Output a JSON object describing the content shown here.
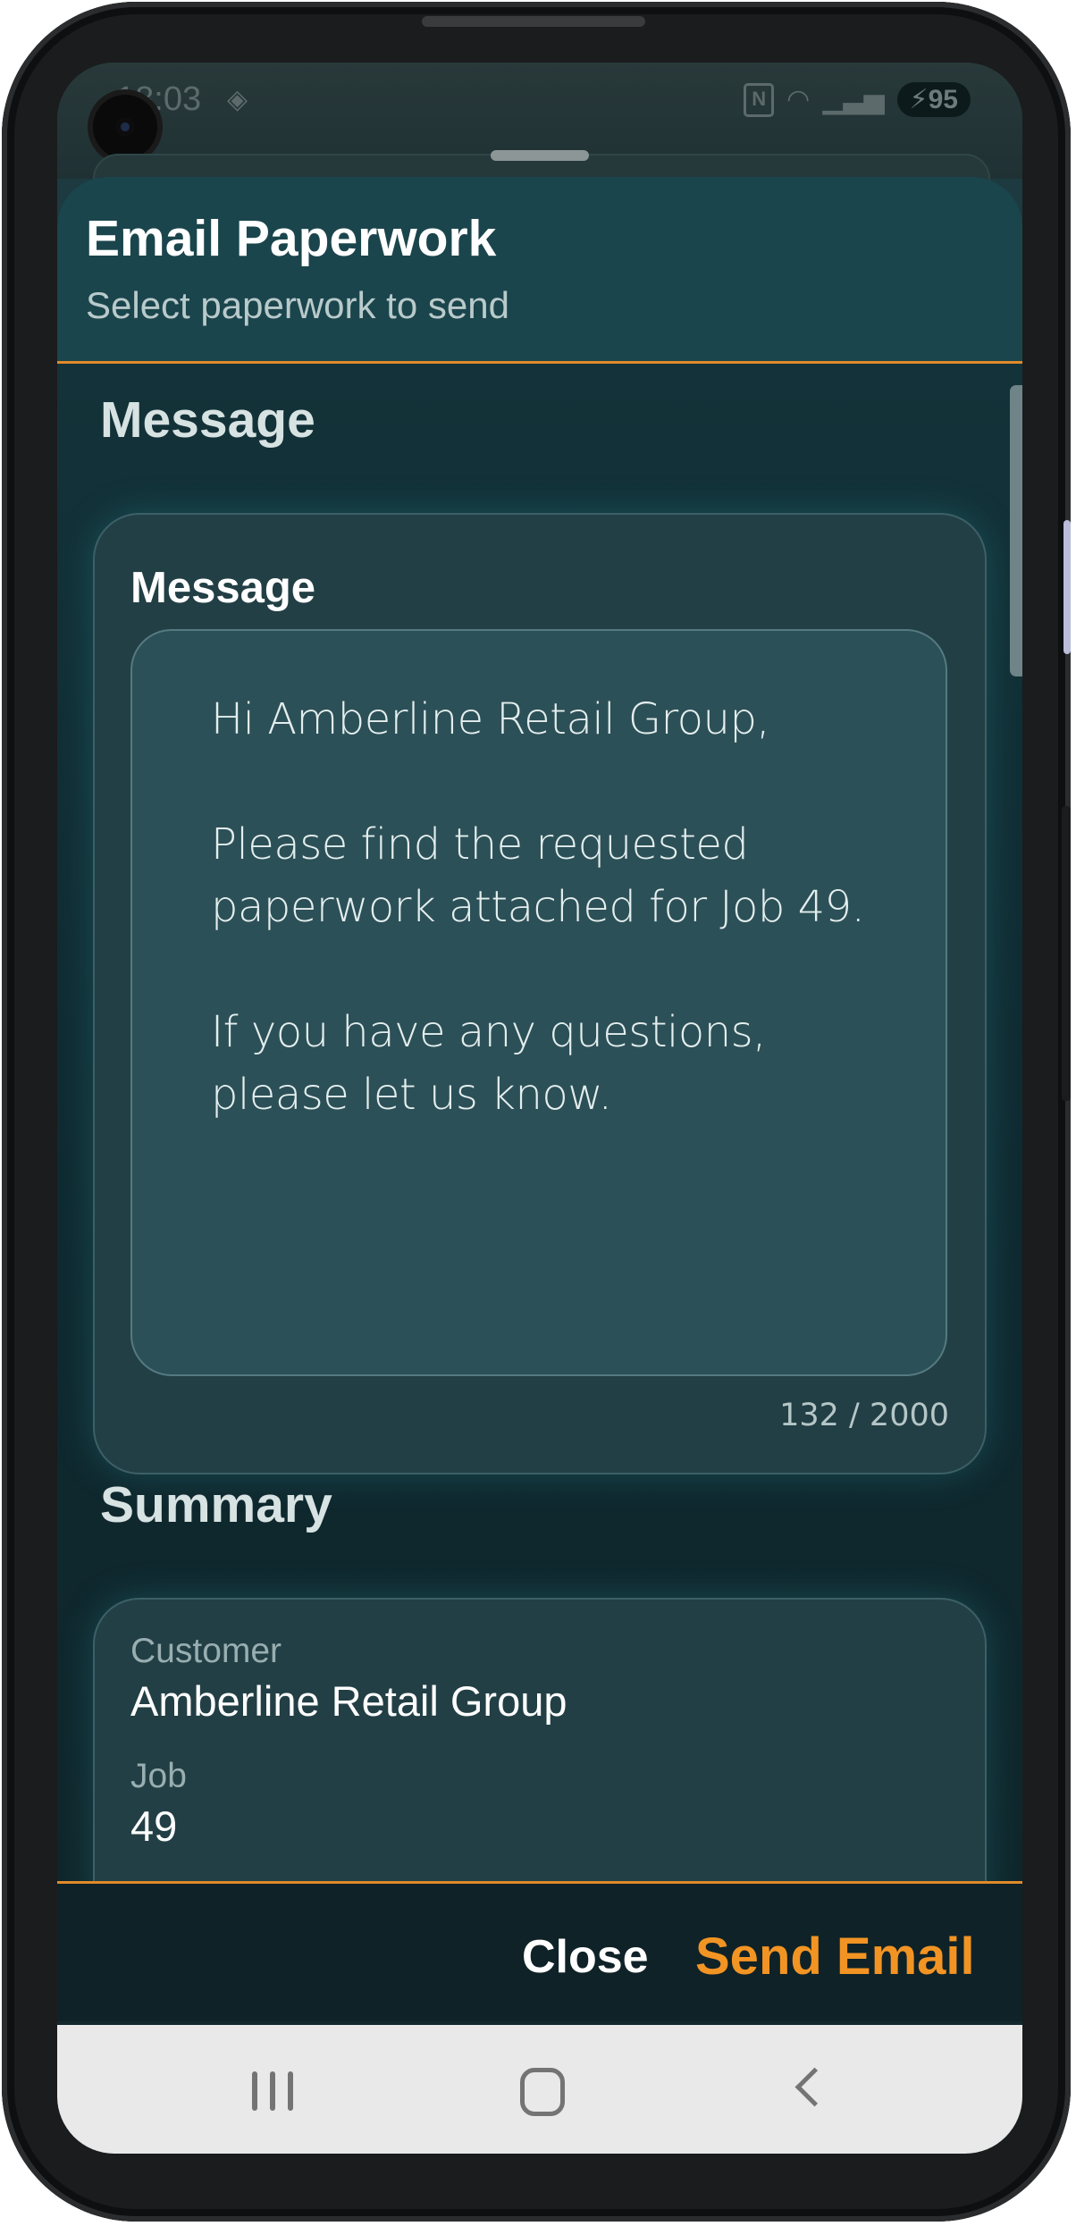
{
  "status_bar": {
    "time": "18:03",
    "battery": "95"
  },
  "sheet": {
    "title": "Email Paperwork",
    "subtitle": "Select paperwork to send"
  },
  "message_section": {
    "heading": "Message",
    "field_label": "Message",
    "body": "Hi Amberline Retail Group,\n\nPlease find the requested paperwork attached for Job 49.\n\nIf you have any questions, please let us know.",
    "counter": "132 / 2000"
  },
  "summary_section": {
    "heading": "Summary",
    "customer_label": "Customer",
    "customer_value": "Amberline Retail Group",
    "job_label": "Job",
    "job_value": "49"
  },
  "footer": {
    "close_label": "Close",
    "send_label": "Send Email"
  },
  "colors": {
    "accent": "#f29424",
    "header_bg": "#1b454c",
    "sheet_bg": "#12292f"
  }
}
